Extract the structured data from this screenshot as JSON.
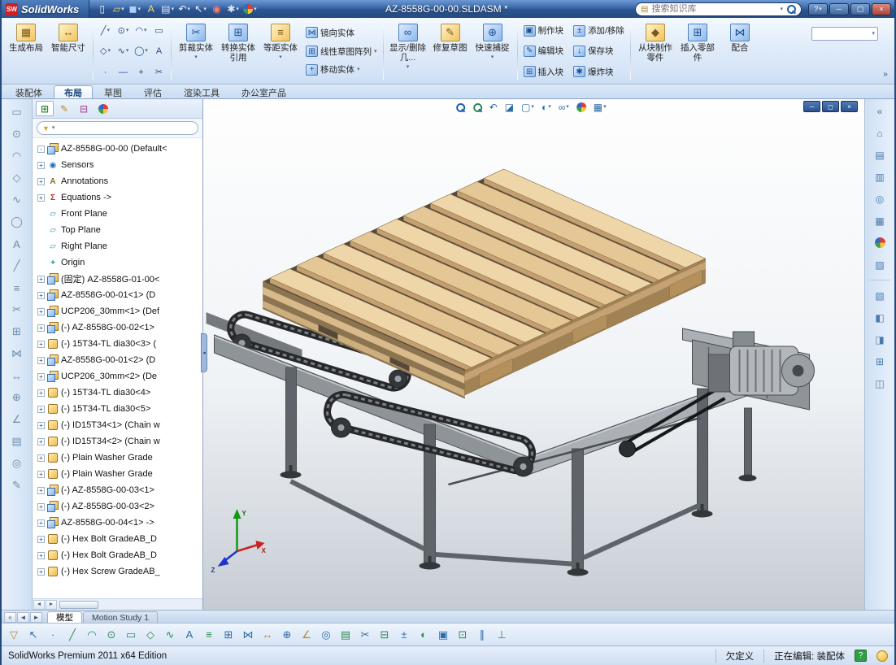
{
  "titlebar": {
    "brand": "SolidWorks",
    "logo_glyph": "SW",
    "doc_title": "AZ-8558G-00-00.SLDASM *",
    "search_placeholder": "搜索知识库",
    "search_book_glyph": "▤",
    "win": {
      "help": "?",
      "min": "─",
      "max": "▢",
      "close": "×"
    },
    "quick_icons": [
      {
        "name": "new-document-button",
        "glyph": "▯",
        "cls": "q-white"
      },
      {
        "name": "open-document-button",
        "glyph": "▱",
        "cls": "q-amber",
        "caret": true
      },
      {
        "name": "save-button",
        "glyph": "◼",
        "cls": "q-blue",
        "caret": true
      },
      {
        "name": "make-drawing-button",
        "glyph": "A",
        "cls": "q-amber"
      },
      {
        "name": "print-button",
        "glyph": "▤",
        "cls": "q-gray",
        "caret": true
      },
      {
        "name": "undo-button",
        "glyph": "↶",
        "cls": "q-white",
        "caret": true
      },
      {
        "name": "select-button",
        "glyph": "↖",
        "cls": "q-white",
        "caret": true
      },
      {
        "name": "rebuild-button",
        "glyph": "◉",
        "cls": "q-red"
      },
      {
        "name": "options-button",
        "glyph": "✱",
        "cls": "q-gray",
        "caret": true
      },
      {
        "name": "edit-appearance-button",
        "cls": "k-ball",
        "caret": true
      }
    ]
  },
  "ribbon": {
    "left_big": [
      {
        "label": "生成布局",
        "icon": "▦",
        "cls": "amber"
      },
      {
        "label": "智能尺寸",
        "icon": "↔",
        "cls": "amber"
      }
    ],
    "sketch_tools": [
      {
        "name": "line-tool",
        "glyph": "╱",
        "caret": true
      },
      {
        "name": "circle-tool",
        "glyph": "⊙",
        "caret": true
      },
      {
        "name": "arc-tool",
        "glyph": "◠",
        "caret": true
      },
      {
        "name": "rectangle-tool",
        "glyph": "▭"
      },
      {
        "name": "polygon-tool",
        "glyph": "◇",
        "caret": true
      },
      {
        "name": "spline-tool",
        "glyph": "∿",
        "caret": true
      },
      {
        "name": "ellipse-tool",
        "glyph": "◯",
        "caret": true
      },
      {
        "name": "text-tool",
        "glyph": "A"
      },
      {
        "name": "point-tool",
        "glyph": "·"
      },
      {
        "name": "centerline-tool",
        "glyph": "—"
      },
      {
        "name": "plus-tool",
        "glyph": "+"
      },
      {
        "name": "trim-small-tool",
        "glyph": "✂"
      }
    ],
    "edit_big": [
      {
        "label": "剪裁实体",
        "icon": "✂",
        "cls": "blue",
        "caret": true
      },
      {
        "label": "转换实体引用",
        "icon": "⊞",
        "cls": "blue"
      },
      {
        "label": "等距实体",
        "icon": "≡",
        "cls": "amber",
        "caret": true
      }
    ],
    "stack1": [
      {
        "label": "镜向实体",
        "icon": "⋈"
      },
      {
        "label": "线性草图阵列",
        "icon": "⊞",
        "caret": true
      },
      {
        "label": "移动实体",
        "icon": "+",
        "caret": true
      }
    ],
    "relation_big": [
      {
        "label": "显示/删除几...",
        "icon": "∞",
        "cls": "blue",
        "caret": true
      },
      {
        "label": "修复草图",
        "icon": "✎",
        "cls": "amber"
      },
      {
        "label": "快速捕捉",
        "icon": "⊕",
        "cls": "blue",
        "caret": true
      }
    ],
    "block_small": [
      {
        "label": "制作块",
        "icon": "▣"
      },
      {
        "label": "编辑块",
        "icon": "✎"
      },
      {
        "label": "插入块",
        "icon": "⊞"
      },
      {
        "label": "添加/移除",
        "icon": "±"
      },
      {
        "label": "保存块",
        "icon": "↓"
      },
      {
        "label": "爆炸块",
        "icon": "✱"
      }
    ],
    "right_big": [
      {
        "label": "从块制作零件",
        "icon": "◆",
        "cls": "amber"
      },
      {
        "label": "插入零部件",
        "icon": "⊞",
        "cls": "blue"
      },
      {
        "label": "配合",
        "icon": "⋈",
        "cls": "blue"
      }
    ],
    "overflow": "»"
  },
  "tabs": [
    {
      "label": "装配体"
    },
    {
      "label": "布局",
      "active": true
    },
    {
      "label": "草图"
    },
    {
      "label": "评估"
    },
    {
      "label": "渲染工具"
    },
    {
      "label": "办公室产品"
    }
  ],
  "headsup": [
    {
      "name": "zoom-fit-icon",
      "cls": "k-mag"
    },
    {
      "name": "zoom-area-icon",
      "cls": "k-mag k-mag2"
    },
    {
      "name": "previous-view-icon",
      "glyph": "↶"
    },
    {
      "name": "section-view-icon",
      "glyph": "◪"
    },
    {
      "name": "view-orientation-icon",
      "glyph": "▢",
      "caret": true
    },
    {
      "name": "display-style-icon",
      "glyph": "◐",
      "caret": true
    },
    {
      "name": "hide-show-items-icon",
      "glyph": "∞",
      "caret": true
    },
    {
      "name": "edit-appearance-icon",
      "cls": "k-ball"
    },
    {
      "name": "apply-scene-icon",
      "glyph": "▦",
      "caret": true
    }
  ],
  "doc_controls": [
    {
      "name": "doc-minimize-button",
      "glyph": "─"
    },
    {
      "name": "doc-restore-button",
      "glyph": "◻"
    },
    {
      "name": "doc-close-button",
      "glyph": "×"
    }
  ],
  "left_toolbar": [
    {
      "name": "rect-tool-icon",
      "glyph": "▭"
    },
    {
      "name": "circle-tool-icon",
      "glyph": "⊙"
    },
    {
      "name": "arc-tool-icon",
      "glyph": "◠"
    },
    {
      "name": "polygon-tool-icon",
      "glyph": "◇"
    },
    {
      "name": "spline-tool-icon",
      "glyph": "∿"
    },
    {
      "name": "ellipse-tool-icon",
      "glyph": "◯"
    },
    {
      "name": "text-tool-icon",
      "glyph": "A"
    },
    {
      "name": "line-tool-icon",
      "glyph": "╱"
    },
    {
      "name": "centerline-tool-icon",
      "glyph": "≡"
    },
    {
      "name": "trim-entities-icon",
      "glyph": "✂"
    },
    {
      "name": "convert-entities-icon",
      "glyph": "⊞"
    },
    {
      "name": "mirror-entities-icon",
      "glyph": "⋈"
    },
    {
      "name": "offset-entities-icon",
      "glyph": "↔"
    },
    {
      "name": "snap-icon",
      "glyph": "⊕"
    },
    {
      "name": "angle-icon",
      "glyph": "∠"
    },
    {
      "name": "table-icon",
      "glyph": "▤"
    },
    {
      "name": "target-icon",
      "glyph": "◎"
    },
    {
      "name": "edit-sketch-icon",
      "glyph": "✎"
    }
  ],
  "task_pane": {
    "top": [
      {
        "name": "collapse-taskpane-icon",
        "glyph": "«"
      },
      {
        "name": "solidworks-resources-icon",
        "glyph": "⌂"
      },
      {
        "name": "design-library-icon",
        "glyph": "▤"
      },
      {
        "name": "file-explorer-icon",
        "glyph": "▥"
      },
      {
        "name": "search-results-icon",
        "glyph": "◎"
      },
      {
        "name": "view-palette-icon",
        "glyph": "▦"
      },
      {
        "name": "appearances-scenes-icon",
        "cls": "k-ball"
      },
      {
        "name": "custom-properties-icon",
        "glyph": "▨"
      }
    ],
    "mid": [
      {
        "name": "task-pane-icon-1",
        "glyph": "▧"
      },
      {
        "name": "task-pane-icon-2",
        "glyph": "◧"
      },
      {
        "name": "task-pane-icon-3",
        "glyph": "◨"
      },
      {
        "name": "task-pane-icon-4",
        "glyph": "⊞"
      },
      {
        "name": "task-pane-icon-5",
        "glyph": "◫"
      }
    ]
  },
  "feature_tree": {
    "panel_tabs": [
      {
        "name": "featuremanager-tab",
        "glyph": "⊞",
        "cls": "g-green",
        "active": true
      },
      {
        "name": "propertymanager-tab",
        "glyph": "✎",
        "cls": "g-amber"
      },
      {
        "name": "configurationmanager-tab",
        "glyph": "⊟",
        "cls": "g-pink"
      },
      {
        "name": "displaymanager-tab",
        "cls": "k-ball"
      }
    ],
    "panel_tabs_more": "»",
    "filter_funnel_glyph": "▼",
    "items": [
      {
        "exp": "-",
        "ic": "asm",
        "label": "AZ-8558G-00-00 (Default<",
        "name": "tree-root"
      },
      {
        "exp": "+",
        "glyph": "◉",
        "cls": "c-sensor",
        "label": "Sensors"
      },
      {
        "exp": "+",
        "glyph": "A",
        "cls": "c-ann",
        "label": "Annotations"
      },
      {
        "exp": "+",
        "glyph": "Σ",
        "cls": "c-eq",
        "label": "Equations ->"
      },
      {
        "glyph": "▱",
        "cls": "c-plane",
        "label": "Front Plane"
      },
      {
        "glyph": "▱",
        "cls": "c-plane",
        "label": "Top Plane"
      },
      {
        "glyph": "▱",
        "cls": "c-plane",
        "label": "Right Plane"
      },
      {
        "glyph": "+",
        "cls": "c-origin",
        "label": "Origin"
      },
      {
        "exp": "+",
        "ic": "asm",
        "label": "(固定) AZ-8558G-01-00<"
      },
      {
        "exp": "+",
        "ic": "asm",
        "label": "AZ-8558G-00-01<1> (D"
      },
      {
        "exp": "+",
        "ic": "asm",
        "label": "UCP206_30mm<1> (Def"
      },
      {
        "exp": "+",
        "ic": "asm",
        "label": "(-) AZ-8558G-00-02<1>"
      },
      {
        "exp": "+",
        "ic": "part",
        "label": "(-) 15T34-TL dia30<3> ("
      },
      {
        "exp": "+",
        "ic": "asm",
        "label": "AZ-8558G-00-01<2> (D"
      },
      {
        "exp": "+",
        "ic": "asm",
        "label": "UCP206_30mm<2> (De"
      },
      {
        "exp": "+",
        "ic": "part",
        "label": "(-) 15T34-TL dia30<4>"
      },
      {
        "exp": "+",
        "ic": "part",
        "label": "(-) 15T34-TL dia30<5>"
      },
      {
        "exp": "+",
        "ic": "part",
        "label": "(-) ID15T34<1> (Chain w"
      },
      {
        "exp": "+",
        "ic": "part",
        "label": "(-) ID15T34<2> (Chain w"
      },
      {
        "exp": "+",
        "ic": "part",
        "label": "(-) Plain Washer Grade"
      },
      {
        "exp": "+",
        "ic": "part",
        "label": "(-) Plain Washer Grade"
      },
      {
        "exp": "+",
        "ic": "asm",
        "label": "(-) AZ-8558G-00-03<1>"
      },
      {
        "exp": "+",
        "ic": "asm",
        "label": "(-) AZ-8558G-00-03<2>"
      },
      {
        "exp": "+",
        "ic": "asm",
        "label": "AZ-8558G-00-04<1> ->"
      },
      {
        "exp": "+",
        "ic": "part",
        "label": "(-) Hex Bolt GradeAB_D"
      },
      {
        "exp": "+",
        "ic": "part",
        "label": "(-) Hex Bolt GradeAB_D"
      },
      {
        "exp": "+",
        "ic": "part",
        "label": "(-) Hex Screw GradeAB_"
      }
    ]
  },
  "model_tabs": {
    "nav": [
      {
        "name": "modeltab-scroll-first",
        "glyph": "«"
      },
      {
        "name": "modeltab-scroll-left",
        "glyph": "◄"
      },
      {
        "name": "modeltab-scroll-right",
        "glyph": "►"
      }
    ],
    "tabs": [
      {
        "label": "模型",
        "active": true
      },
      {
        "label": "Motion Study 1"
      }
    ]
  },
  "bottom_toolbar": [
    {
      "name": "selection-filter-toggle-icon",
      "glyph": "▽",
      "cls": "c3"
    },
    {
      "name": "select-arrow-icon",
      "glyph": "↖",
      "cls": "c2"
    },
    {
      "name": "filter-vertices-icon",
      "glyph": "·",
      "cls": "c2"
    },
    {
      "name": "filter-edges-icon",
      "glyph": "╱",
      "cls": "c1"
    },
    {
      "glyph": "◠",
      "cls": "c1"
    },
    {
      "glyph": "⊙",
      "cls": "c1"
    },
    {
      "glyph": "▭",
      "cls": "c1"
    },
    {
      "glyph": "◇",
      "cls": "c1"
    },
    {
      "glyph": "∿",
      "cls": "c1"
    },
    {
      "glyph": "A",
      "cls": "c2"
    },
    {
      "glyph": "≡",
      "cls": "c1"
    },
    {
      "glyph": "⊞",
      "cls": "c2"
    },
    {
      "glyph": "⋈",
      "cls": "c2"
    },
    {
      "glyph": "↔",
      "cls": "c3"
    },
    {
      "glyph": "⊕",
      "cls": "c2"
    },
    {
      "glyph": "∠",
      "cls": "c3"
    },
    {
      "glyph": "◎",
      "cls": "c2"
    },
    {
      "glyph": "▤",
      "cls": "c1"
    },
    {
      "glyph": "✂",
      "cls": "c2"
    },
    {
      "glyph": "⊟",
      "cls": "c1"
    },
    {
      "glyph": "±",
      "cls": "c2"
    },
    {
      "glyph": "◐",
      "cls": "c1"
    },
    {
      "glyph": "▣",
      "cls": "c2"
    },
    {
      "glyph": "⊡",
      "cls": "c1"
    },
    {
      "glyph": "∥",
      "cls": "c2"
    },
    {
      "glyph": "⊥",
      "cls": "c1"
    }
  ],
  "statusbar": {
    "edition": "SolidWorks Premium 2011 x64 Edition",
    "constraint": "欠定义",
    "editing": "正在编辑: 装配体",
    "help_glyph": "?"
  },
  "viewport": {
    "triad": {
      "x": "X",
      "y": "Y",
      "z": "Z"
    },
    "colors": {
      "wood_top": "#eed6a8",
      "wood_top_alt": "#e5c795",
      "wood_side": "#c4a071",
      "wood_end": "#ad8b5c",
      "wood_edge": "#8a6f48",
      "wood_dark": "#57493a",
      "wood_face": "#8b744f",
      "wood_stringer": "#d9ba8a",
      "wood_bottom": "#ccae7f",
      "wood_face_r": "#a08254",
      "wood_end_strip": "#c5a273",
      "wood_block": "#b3905c",
      "frame": "#8f9498",
      "frame_light": "#aab0b5",
      "frame_dark": "#4a4e52",
      "frame_far": "#75797d",
      "leg": "#5f646a",
      "chain": "#26282b",
      "chain_in": "#7b7f83",
      "foot": "#33373a",
      "motor": "#b2b7bb",
      "motor_dark": "#6e7276",
      "belt": "#17181a",
      "triad_x": "#cc2222",
      "triad_y": "#119911",
      "triad_z": "#2233cc"
    }
  }
}
